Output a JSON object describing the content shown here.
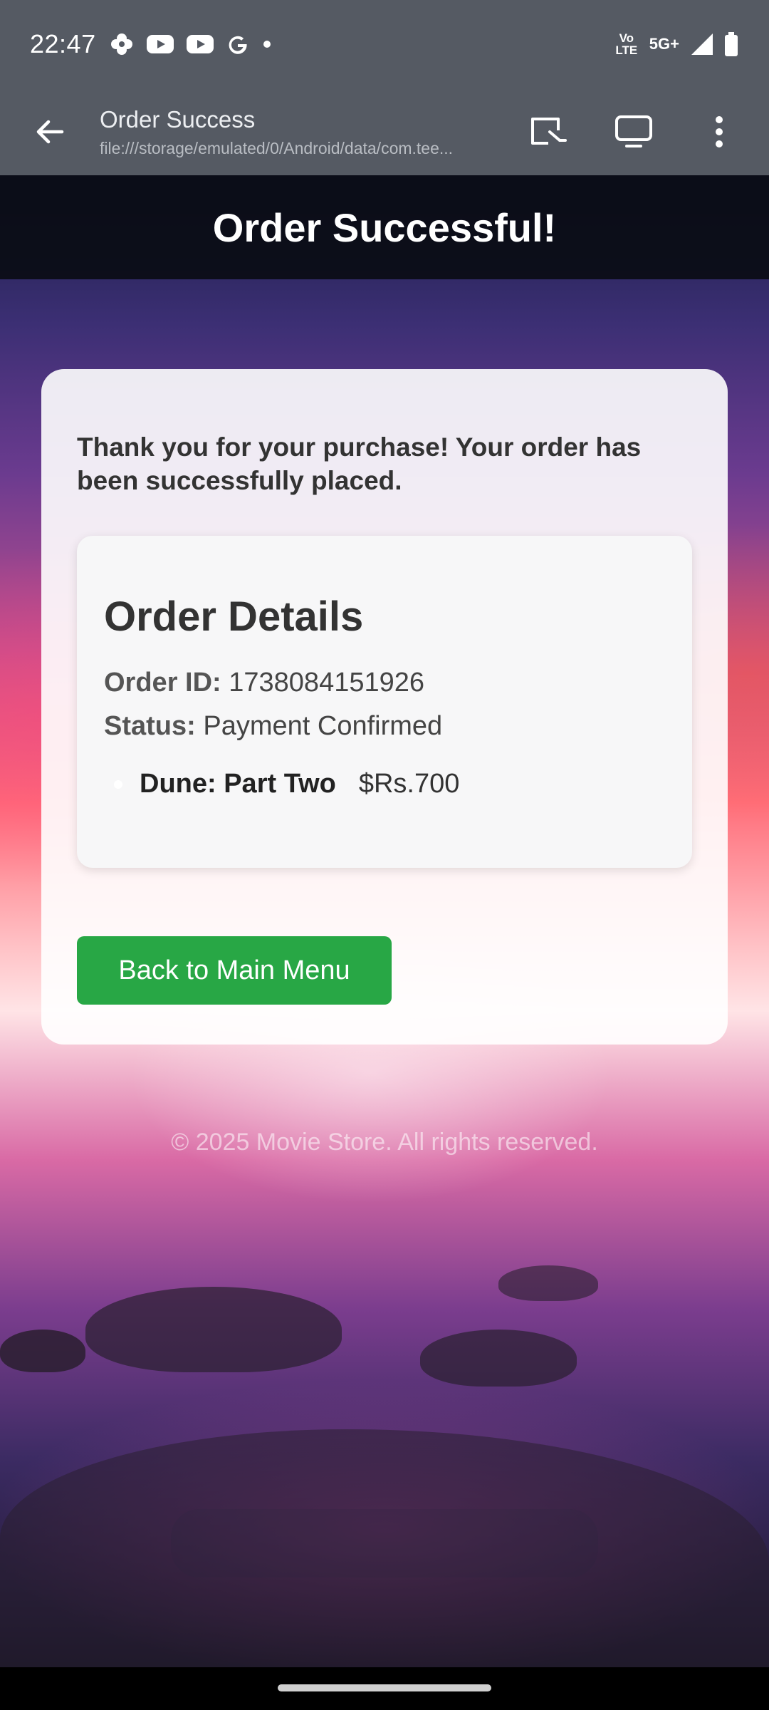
{
  "status_bar": {
    "time": "22:47",
    "left_icons": [
      "pinwheel-icon",
      "youtube-icon",
      "youtube-icon",
      "google-icon",
      "dot-icon"
    ],
    "volte_label": "Vo LTE",
    "network": "5G+",
    "right_icons": [
      "signal-icon",
      "battery-icon"
    ]
  },
  "browser": {
    "title": "Order Success",
    "url": "file:///storage/emulated/0/Android/data/com.tee..."
  },
  "page": {
    "header_title": "Order Successful!",
    "thank_you": "Thank you for your purchase! Your order has been successfully placed.",
    "details_title": "Order Details",
    "order_id_label": "Order ID:",
    "order_id": "1738084151926",
    "status_label": "Status:",
    "status_value": "Payment Confirmed",
    "items": [
      {
        "name": "Dune: Part Two",
        "price": "$Rs.700"
      }
    ],
    "back_button": "Back to Main Menu",
    "footer": "© 2025 Movie Store. All rights reserved."
  },
  "colors": {
    "chrome": "#555a63",
    "button_green": "#28a745",
    "header_dark": "#0a0c14"
  }
}
